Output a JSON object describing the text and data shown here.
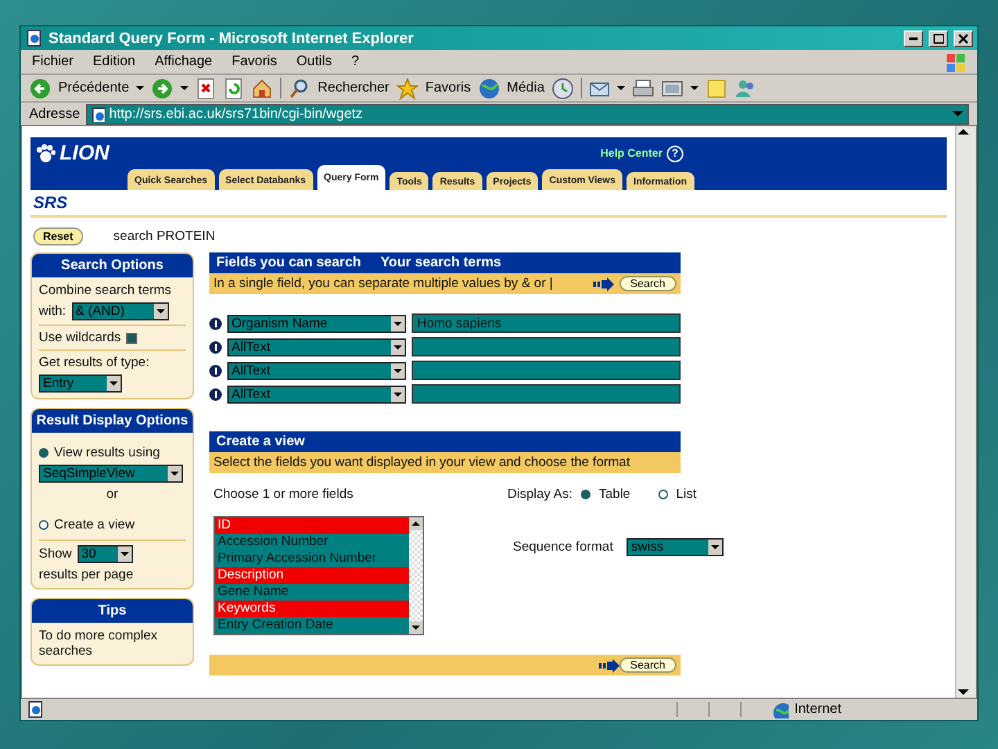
{
  "window": {
    "title": "Standard Query Form - Microsoft Internet Explorer"
  },
  "menu": [
    "Fichier",
    "Edition",
    "Affichage",
    "Favoris",
    "Outils",
    "?"
  ],
  "toolbar": {
    "back": "Précédente",
    "search": "Rechercher",
    "favorites": "Favoris",
    "media": "Média"
  },
  "address": {
    "label": "Adresse",
    "url": "http://srs.ebi.ac.uk/srs71bin/cgi-bin/wgetz"
  },
  "site": {
    "logo": "LION",
    "help": "Help Center",
    "help_icon": "?",
    "brand": "SRS",
    "tabs": [
      {
        "label": "Quick Searches",
        "selected": false
      },
      {
        "label": "Select Databanks",
        "selected": false
      },
      {
        "label": "Query Form",
        "selected": true
      },
      {
        "label": "Tools",
        "selected": false
      },
      {
        "label": "Results",
        "selected": false
      },
      {
        "label": "Projects",
        "selected": false
      },
      {
        "label": "Custom Views",
        "selected": false
      },
      {
        "label": "Information",
        "selected": false
      }
    ],
    "reset": "Reset",
    "search_label": "search PROTEIN"
  },
  "search_options": {
    "title": "Search Options",
    "combine_label": "Combine search terms",
    "with_label": "with:",
    "combine_value": "& (AND)",
    "wildcards_label": "Use wildcards",
    "wildcards_checked": true,
    "type_label": "Get results of type:",
    "type_value": "Entry"
  },
  "result_display": {
    "title": "Result Display Options",
    "view_using": {
      "label": "View results using",
      "selected": true
    },
    "view_value": "SeqSimpleView",
    "or": "or",
    "create_view": {
      "label": "Create a view",
      "selected": false
    },
    "show_label": "Show",
    "show_value": "30",
    "per_page": "results per page"
  },
  "tips": {
    "title": "Tips",
    "text": "To do more complex searches"
  },
  "fields_panel": {
    "header_fields": "Fields you can search",
    "header_terms": "Your search terms",
    "hint": "In a single field, you can separate multiple values by & or |",
    "search_button": "Search",
    "rows": [
      {
        "field": "Organism Name",
        "value": "Homo sapiens"
      },
      {
        "field": "AllText",
        "value": ""
      },
      {
        "field": "AllText",
        "value": ""
      },
      {
        "field": "AllText",
        "value": ""
      }
    ]
  },
  "view_panel": {
    "title": "Create a view",
    "hint": "Select the fields you want displayed in your view and choose the format",
    "choose_label": "Choose 1 or more fields",
    "search_button": "Search",
    "fields": [
      {
        "label": "ID",
        "selected": true
      },
      {
        "label": "Accession Number",
        "selected": false
      },
      {
        "label": "Primary Accession Number",
        "selected": false
      },
      {
        "label": "Description",
        "selected": true
      },
      {
        "label": "Gene Name",
        "selected": false
      },
      {
        "label": "Keywords",
        "selected": true
      },
      {
        "label": "Entry Creation Date",
        "selected": false
      }
    ],
    "display_label": "Display As:",
    "display_options": [
      {
        "label": "Table",
        "selected": true
      },
      {
        "label": "List",
        "selected": false
      }
    ],
    "format_label": "Sequence format",
    "format_value": "swiss"
  },
  "status_bar": {
    "zone": "Internet"
  }
}
